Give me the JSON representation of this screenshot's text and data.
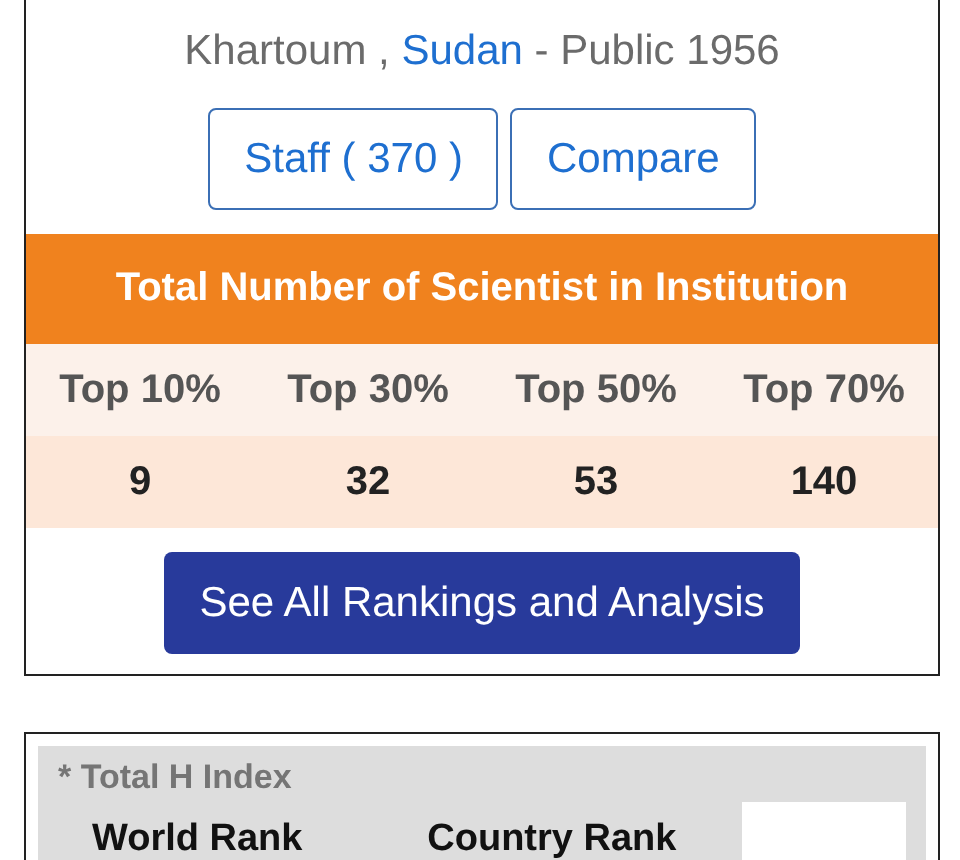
{
  "location": {
    "city": "Khartoum ,",
    "country": "Sudan",
    "suffix": "- Public 1956"
  },
  "buttons": [
    "Staff ( 370 )",
    "Compare"
  ],
  "scientists": {
    "title": "Total Number of Scientist in Institution",
    "columns": [
      "Top 10%",
      "Top 30%",
      "Top 50%",
      "Top 70%"
    ],
    "values": [
      "9",
      "32",
      "53",
      "140"
    ]
  },
  "rankings_button": "See All Rankings and Analysis",
  "h_index": {
    "title": "* Total H Index",
    "columns": [
      "World Rank",
      "Country Rank"
    ]
  }
}
